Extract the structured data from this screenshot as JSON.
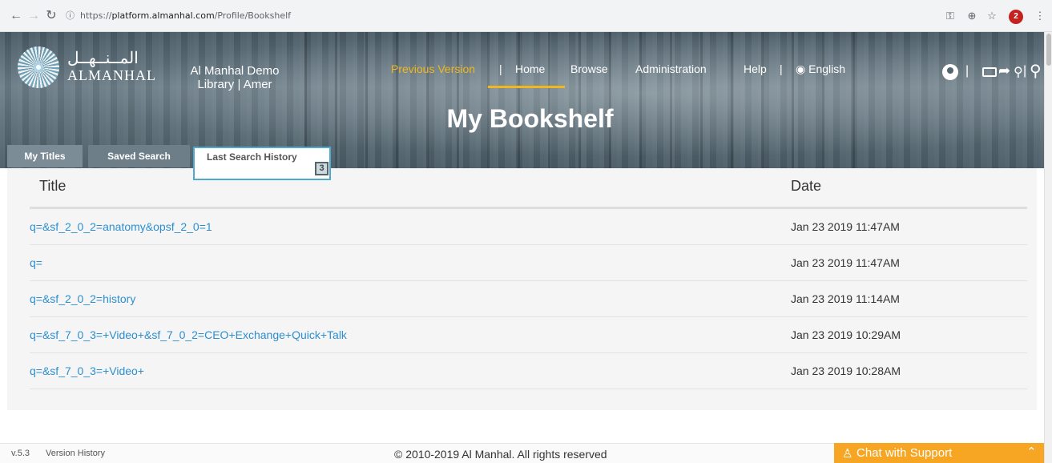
{
  "browser": {
    "url_prefix": "https://",
    "url_host": "platform.almanhal.com",
    "url_path": "/Profile/Bookshelf",
    "profile_badge": "2"
  },
  "brand": {
    "logo_arabic": "المــنــهــل",
    "logo_latin": "ALMANHAL",
    "library_line1": "Al Manhal Demo",
    "library_line2": "Library | Amer"
  },
  "topnav": {
    "previous_version": "Previous Version",
    "sep": "|",
    "home": "Home",
    "browse": "Browse",
    "administration": "Administration",
    "help": "Help",
    "english": "English"
  },
  "hero": {
    "title": "My Bookshelf"
  },
  "tabs": {
    "my_titles": "My Titles",
    "saved_search": "Saved Search",
    "last_search_history": "Last Search History",
    "badge": "3"
  },
  "table": {
    "headers": {
      "title": "Title",
      "date": "Date"
    },
    "rows": [
      {
        "title": "q=&sf_2_0_2=anatomy&opsf_2_0=1",
        "date": "Jan 23 2019 11:47AM"
      },
      {
        "title": "q=",
        "date": "Jan 23 2019 11:47AM"
      },
      {
        "title": "q=&sf_2_0_2=history",
        "date": "Jan 23 2019 11:14AM"
      },
      {
        "title": "q=&sf_7_0_3=+Video+&sf_7_0_2=CEO+Exchange+Quick+Talk",
        "date": "Jan 23 2019 10:29AM"
      },
      {
        "title": "q=&sf_7_0_3=+Video+",
        "date": "Jan 23 2019 10:28AM"
      }
    ]
  },
  "footer": {
    "version": "v.5.3",
    "version_history": "Version History",
    "copyright": "© 2010-2019 Al Manhal. All rights reserved"
  },
  "chat": {
    "label": "Chat with Support"
  },
  "colors": {
    "accent": "#f1b81c",
    "link": "#2d8fcf",
    "chat": "#f6a623",
    "tab_focus": "#4fa8cf"
  }
}
